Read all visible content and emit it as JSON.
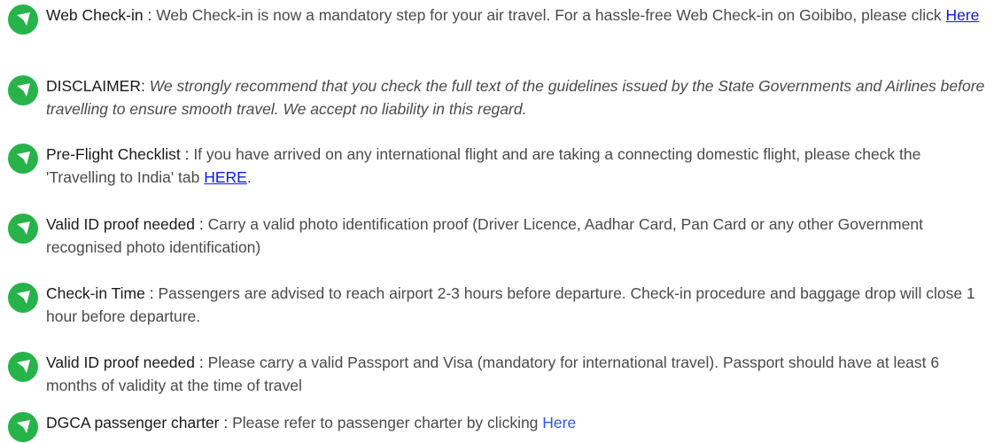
{
  "items": [
    {
      "label": "Web Check-in :",
      "text": "Web Check-in is now a mandatory step for your air travel. For a hassle-free Web Check-in on Goibibo, please click",
      "link": "Here",
      "icon": "location-arrow-icon"
    },
    {
      "label": "DISCLAIMER:",
      "text": "We strongly recommend that you check the full text of the guidelines issued by the State Governments and Airlines before travelling to ensure smooth travel. We accept no liability in this regard.",
      "icon": "location-arrow-icon"
    },
    {
      "label": "Pre-Flight Checklist :",
      "text": "If you have arrived on any international flight and are taking a connecting domestic flight, please check the 'Travelling to India' tab",
      "link": "HERE",
      "suffix": ".",
      "icon": "location-arrow-icon"
    },
    {
      "label": "Valid ID proof needed :",
      "text": "Carry a valid photo identification proof (Driver Licence, Aadhar Card, Pan Card or any other Government recognised photo identification)",
      "icon": "location-arrow-icon"
    },
    {
      "label": "Check-in Time :",
      "text": "Passengers are advised to reach airport 2-3 hours before departure. Check-in procedure and baggage drop will close 1 hour before departure.",
      "icon": "location-arrow-icon"
    },
    {
      "label": "Valid ID proof needed :",
      "text": "Please carry a valid Passport and Visa (mandatory for international travel). Passport should have at least 6 months of validity at the time of travel",
      "icon": "location-arrow-icon"
    },
    {
      "label": "DGCA passenger charter :",
      "text": "Please refer to passenger charter by clicking",
      "link": "Here",
      "icon": "location-arrow-icon"
    }
  ],
  "colors": {
    "icon_bg": "#27b34a",
    "link": "#0a1be0",
    "label": "#1a1a1a",
    "body_text": "#4a4a4a"
  }
}
